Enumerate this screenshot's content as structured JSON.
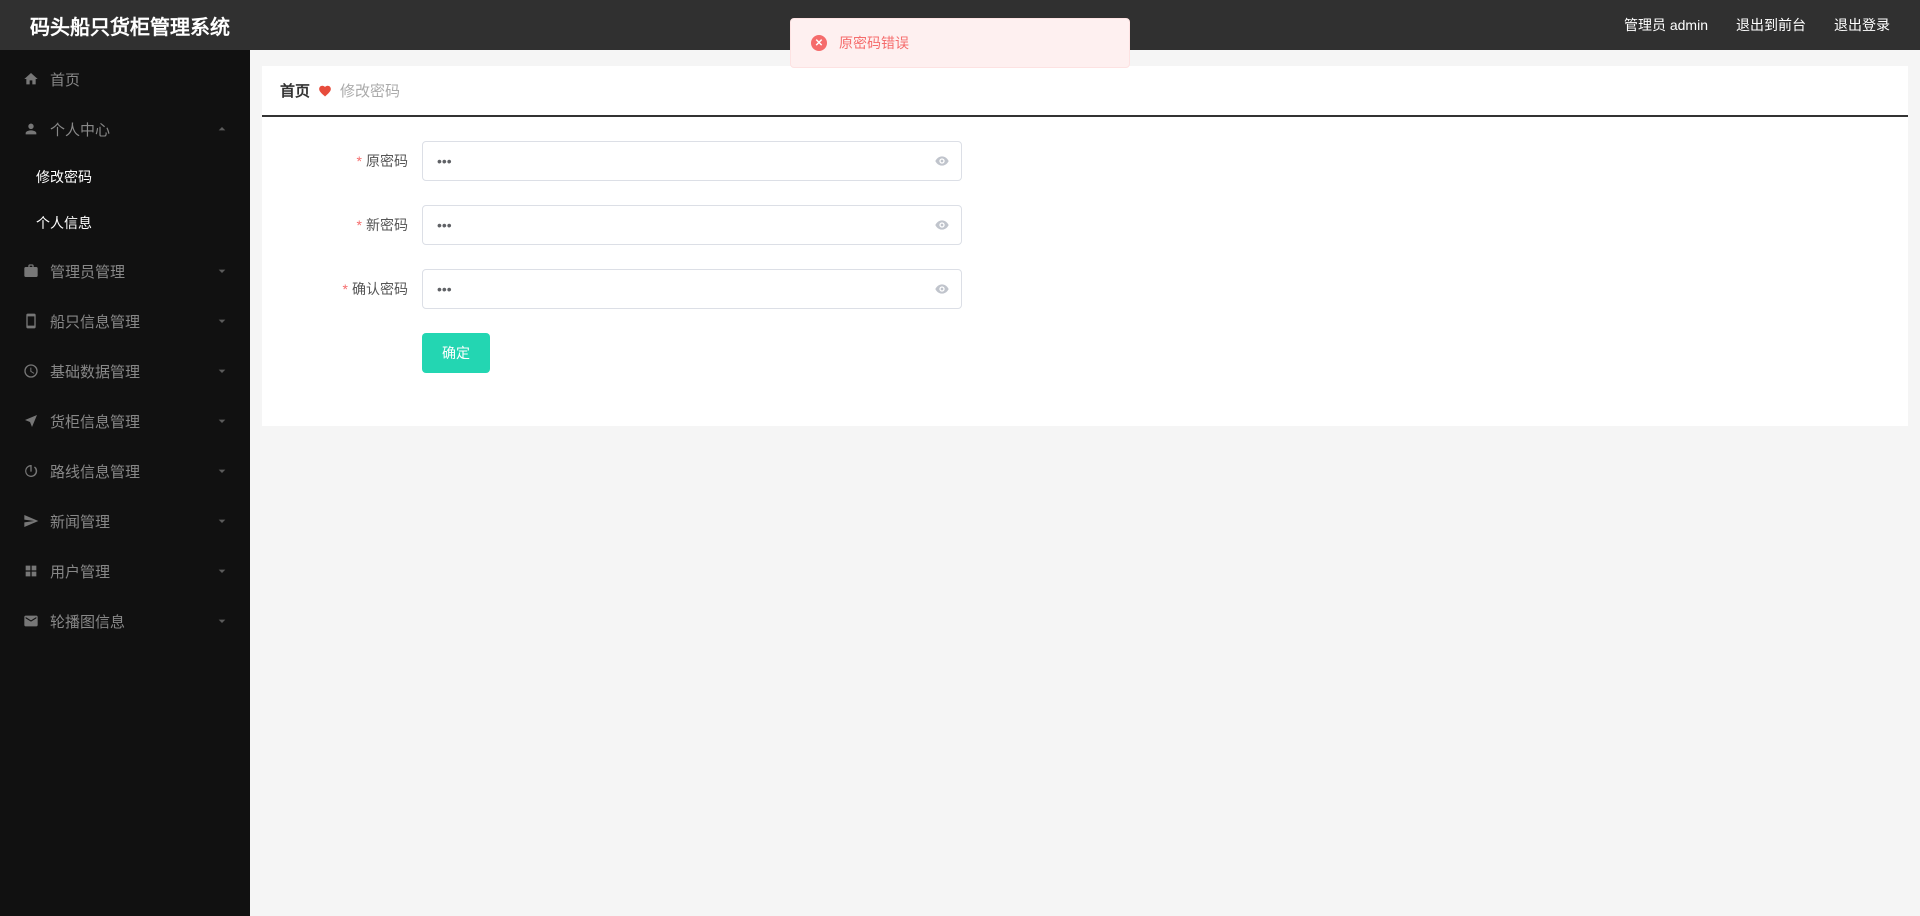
{
  "header": {
    "title": "码头船只货柜管理系统",
    "user_label": "管理员 admin",
    "exit_front": "退出到前台",
    "logout": "退出登录"
  },
  "sidebar": {
    "home": "首页",
    "personal": "个人中心",
    "change_pw": "修改密码",
    "personal_info": "个人信息",
    "admin_mgmt": "管理员管理",
    "ship_info": "船只信息管理",
    "base_data": "基础数据管理",
    "container": "货柜信息管理",
    "route": "路线信息管理",
    "news": "新闻管理",
    "user_mgmt": "用户管理",
    "carousel": "轮播图信息"
  },
  "breadcrumb": {
    "home": "首页",
    "curr": "修改密码"
  },
  "form": {
    "old_pw_label": "原密码",
    "new_pw_label": "新密码",
    "confirm_pw_label": "确认密码",
    "submit": "确定",
    "old_pw_value": "•••",
    "new_pw_value": "•••",
    "confirm_pw_value": "•••"
  },
  "notification": {
    "text": "原密码错误"
  }
}
